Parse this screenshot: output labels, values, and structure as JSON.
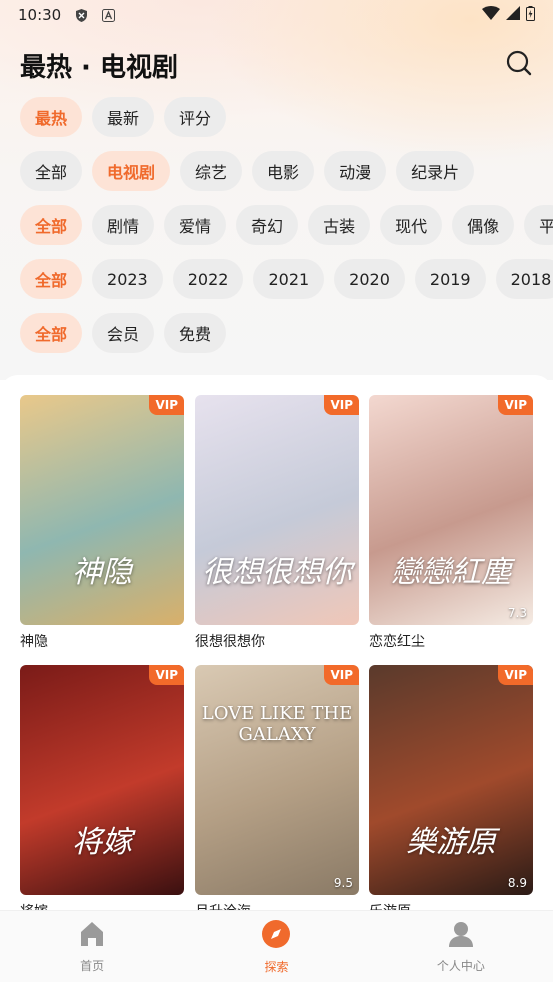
{
  "status": {
    "time": "10:30"
  },
  "header": {
    "title": "最热 · 电视剧"
  },
  "filters": {
    "sort": [
      "最热",
      "最新",
      "评分"
    ],
    "category": [
      "全部",
      "电视剧",
      "综艺",
      "电影",
      "动漫",
      "纪录片"
    ],
    "genre": [
      "全部",
      "剧情",
      "爱情",
      "奇幻",
      "古装",
      "现代",
      "偶像",
      "平"
    ],
    "year": [
      "全部",
      "2023",
      "2022",
      "2021",
      "2020",
      "2019",
      "2018"
    ],
    "pay": [
      "全部",
      "会员",
      "免费"
    ]
  },
  "cards": [
    {
      "name": "神隐",
      "badge": "VIP",
      "score": "",
      "art": "神隐",
      "colors": [
        "#e9c88a",
        "#8fb7b0",
        "#d9b06a"
      ]
    },
    {
      "name": "很想很想你",
      "badge": "VIP",
      "score": "",
      "art": "很想很想你",
      "colors": [
        "#e7e2ee",
        "#c5cad8",
        "#f0c7b8"
      ]
    },
    {
      "name": "恋恋红尘",
      "badge": "VIP",
      "score": "7.3",
      "art": "戀戀紅塵",
      "colors": [
        "#f3d8d0",
        "#c79a8e",
        "#f5ebe3"
      ]
    },
    {
      "name": "将嫁",
      "badge": "VIP",
      "score": "",
      "art": "将嫁",
      "colors": [
        "#7a1b18",
        "#c23b2b",
        "#3a1010"
      ]
    },
    {
      "name": "月升沧海",
      "badge": "VIP",
      "score": "9.5",
      "art": "LOVE LIKE THE GALAXY",
      "colors": [
        "#d9c9b3",
        "#b49f85",
        "#8a7a66"
      ]
    },
    {
      "name": "乐游原",
      "badge": "VIP",
      "score": "8.9",
      "art": "樂游原",
      "colors": [
        "#5a3a2c",
        "#a04a2c",
        "#2b1b16"
      ]
    }
  ],
  "nav": [
    {
      "label": "首页",
      "icon": "home-icon"
    },
    {
      "label": "探索",
      "icon": "explore-icon"
    },
    {
      "label": "个人中心",
      "icon": "user-icon"
    }
  ],
  "colors": {
    "accent": "#f06a2c",
    "chip_bg": "#ececec",
    "chip_active_bg": "#fde3d6"
  }
}
